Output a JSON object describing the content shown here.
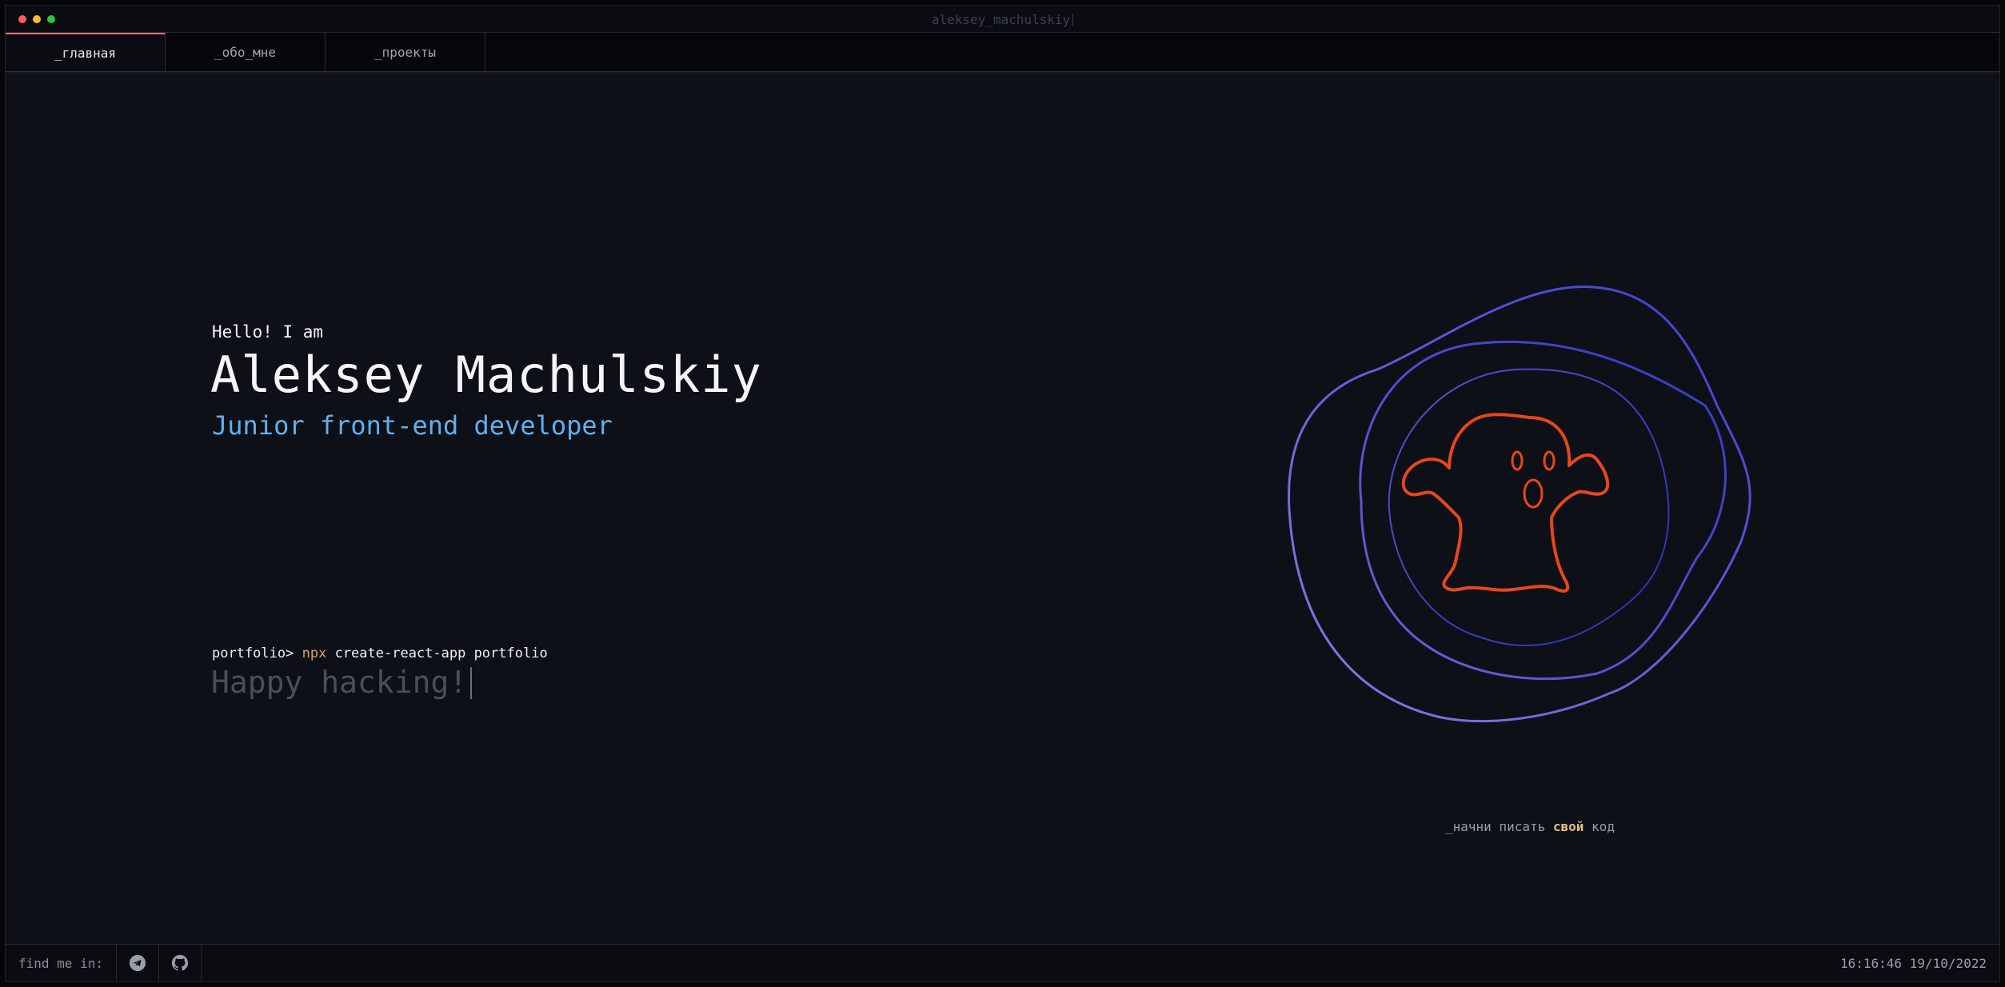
{
  "window": {
    "title": "aleksey_machulskiy"
  },
  "tabs": [
    {
      "label": "_главная",
      "active": true
    },
    {
      "label": "_обо_мне",
      "active": false
    },
    {
      "label": "_проекты",
      "active": false
    }
  ],
  "hero": {
    "greeting": "Hello! I am",
    "name": "Aleksey Machulskiy",
    "role": "Junior front-end developer"
  },
  "terminal": {
    "prompt": "portfolio>",
    "command_keyword": "npx",
    "command_rest": "create-react-app portfolio",
    "output": "Happy hacking!"
  },
  "illustration": {
    "icon": "ghost-icon",
    "ring_color": "#5a4fcf",
    "ghost_color": "#e8461b"
  },
  "tagline": {
    "before": "_начни писать",
    "highlight": "свой",
    "after": "код"
  },
  "footer": {
    "find_label": "find me in:",
    "socials": [
      {
        "icon": "telegram-icon"
      },
      {
        "icon": "github-icon"
      }
    ],
    "datetime": "16:16:46 19/10/2022"
  }
}
